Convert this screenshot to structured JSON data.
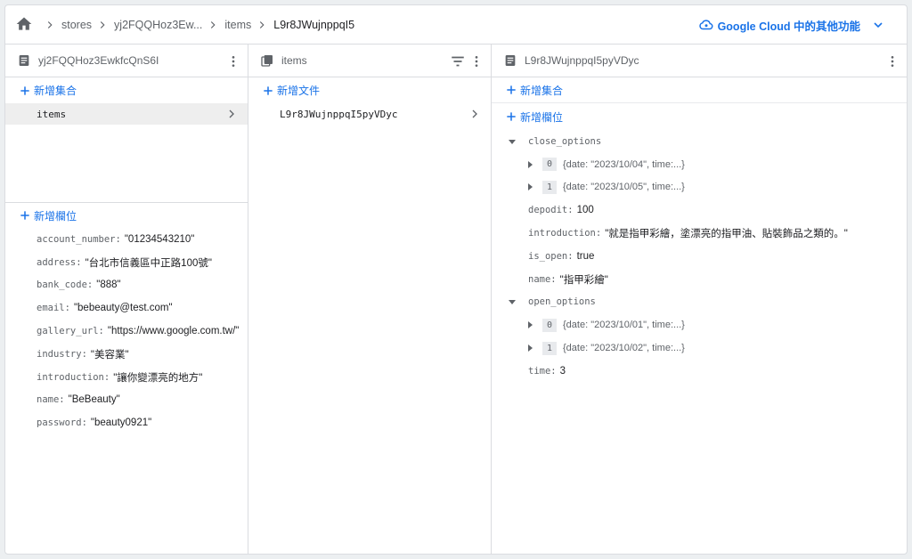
{
  "breadcrumb": {
    "items": [
      "stores",
      "yj2FQQHoz3Ew...",
      "items",
      "L9r8JWujnppqI5"
    ],
    "gcloud_label": "Google Cloud 中的其他功能"
  },
  "col1": {
    "title": "yj2FQQHoz3EwkfcQnS6I",
    "add_collection": "新增集合",
    "collections": [
      "items"
    ],
    "add_field": "新增欄位",
    "fields": [
      {
        "key": "account_number:",
        "value": "01234543210"
      },
      {
        "key": "address:",
        "value": "台北市信義區中正路100號"
      },
      {
        "key": "bank_code:",
        "value": "888"
      },
      {
        "key": "email:",
        "value": "bebeauty@test.com"
      },
      {
        "key": "gallery_url:",
        "value": "https://www.google.com.tw/"
      },
      {
        "key": "industry:",
        "value": "美容業"
      },
      {
        "key": "introduction:",
        "value": "讓你變漂亮的地方"
      },
      {
        "key": "name:",
        "value": "BeBeauty"
      },
      {
        "key": "password:",
        "value": "beauty0921"
      }
    ]
  },
  "col2": {
    "title": "items",
    "add_document": "新增文件",
    "documents": [
      "L9r8JWujnppqI5pyVDyc"
    ]
  },
  "col3": {
    "title": "L9r8JWujnppqI5pyVDyc",
    "add_collection": "新增集合",
    "add_field": "新增欄位",
    "close_options_key": "close_options",
    "close_options": [
      {
        "index": "0",
        "summary": "{date: \"2023/10/04\", time:...}"
      },
      {
        "index": "1",
        "summary": "{date: \"2023/10/05\", time:...}"
      }
    ],
    "depodit_key": "depodit:",
    "depodit_value": "100",
    "introduction_key": "introduction:",
    "introduction_value": "就是指甲彩繪，塗漂亮的指甲油、貼裝飾品之類的。",
    "is_open_key": "is_open:",
    "is_open_value": "true",
    "name_key": "name:",
    "name_value": "指甲彩繪",
    "open_options_key": "open_options",
    "open_options": [
      {
        "index": "0",
        "summary": "{date: \"2023/10/01\", time:...}"
      },
      {
        "index": "1",
        "summary": "{date: \"2023/10/02\", time:...}"
      }
    ],
    "time_key": "time:",
    "time_value": "3"
  },
  "colors": {
    "accent": "#1a73e8",
    "border": "#dadce0",
    "muted": "#5f6368",
    "selected": "#eeeeee"
  },
  "icons": [
    "home-icon",
    "chevron-right-icon",
    "cloud-icon",
    "chevron-down-icon",
    "document-icon",
    "collection-icon",
    "filter-icon",
    "more-vert-icon",
    "plus-icon",
    "caret-down-icon",
    "caret-right-icon"
  ]
}
